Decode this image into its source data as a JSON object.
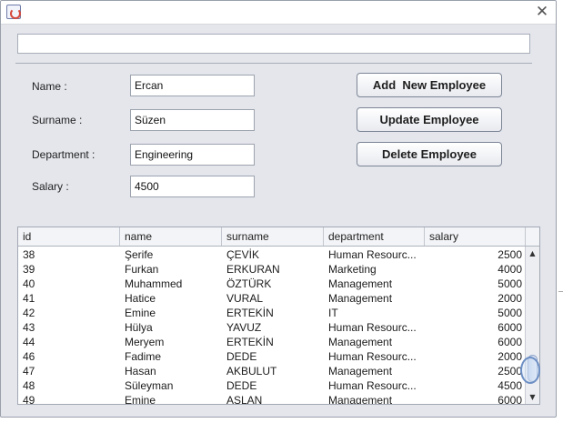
{
  "window": {
    "icon": "java-cup-icon",
    "close_glyph": "✕",
    "search_value": ""
  },
  "form": {
    "name_label": "Name :",
    "name_value": "Ercan",
    "surname_label": "Surname :",
    "surname_value": "Süzen",
    "department_label": "Department :",
    "department_value": "Engineering",
    "salary_label": "Salary :",
    "salary_value": "4500"
  },
  "buttons": {
    "add": "Add  New Employee",
    "update": "Update Employee",
    "delete": "Delete Employee"
  },
  "table": {
    "columns": [
      "id",
      "name",
      "surname",
      "department",
      "salary"
    ],
    "rows": [
      [
        "38",
        "Şerife",
        "ÇEVİK",
        "Human Resourc...",
        "2500"
      ],
      [
        "39",
        "Furkan",
        "ERKURAN",
        "Marketing",
        "4000"
      ],
      [
        "40",
        "Muhammed",
        "ÖZTÜRK",
        "Management",
        "5000"
      ],
      [
        "41",
        "Hatice",
        "VURAL",
        "Management",
        "2000"
      ],
      [
        "42",
        "Emine",
        "ERTEKİN",
        "IT",
        "5000"
      ],
      [
        "43",
        "Hülya",
        "YAVUZ",
        "Human Resourc...",
        "6000"
      ],
      [
        "44",
        "Meryem",
        "ERTEKİN",
        "Management",
        "6000"
      ],
      [
        "46",
        "Fadime",
        "DEDE",
        "Human Resourc...",
        "2000"
      ],
      [
        "47",
        "Hasan",
        "AKBULUT",
        "Management",
        "2500"
      ],
      [
        "48",
        "Süleyman",
        "DEDE",
        "Human Resourc...",
        "4500"
      ],
      [
        "49",
        "Emine",
        "ASLAN",
        "Management",
        "6000"
      ]
    ],
    "scroll_up_glyph": "▲",
    "scroll_down_glyph": "▼",
    "scroll_fraction": 0.92
  }
}
